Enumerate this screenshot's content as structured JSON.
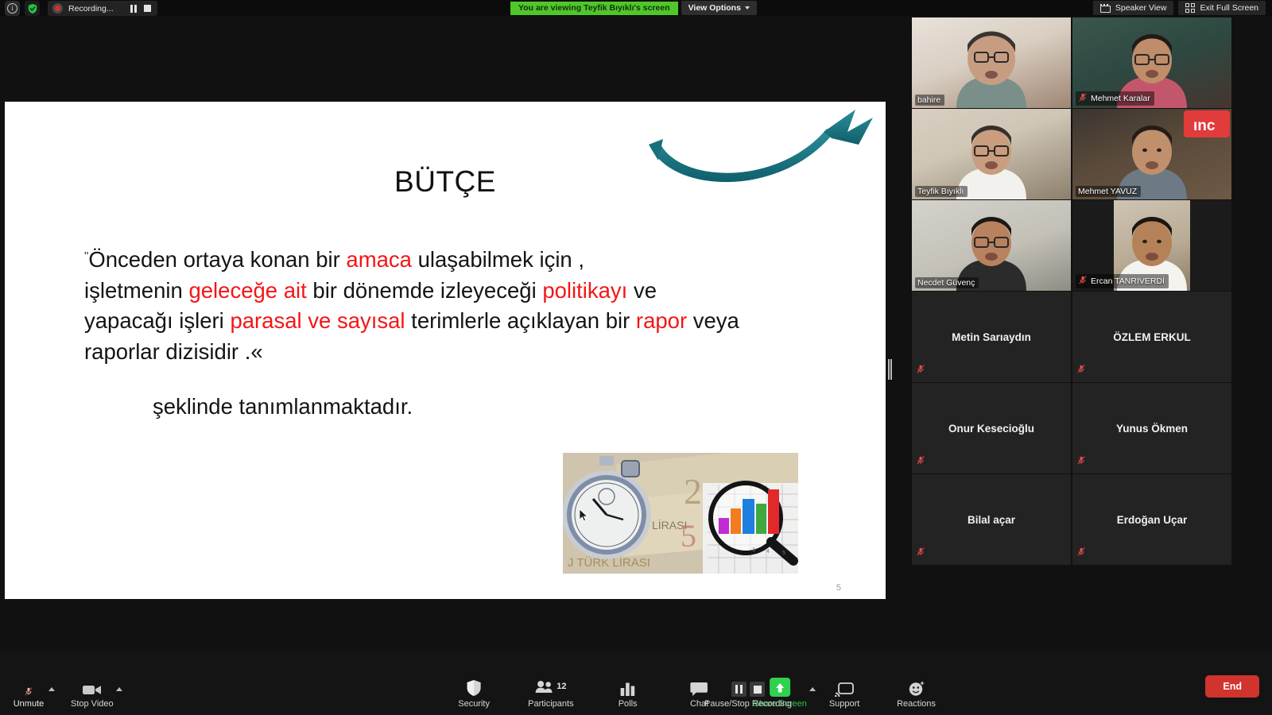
{
  "topbar": {
    "info_icon": "info-icon",
    "shield_icon": "shield-check-icon",
    "recording_label": "Recording...",
    "pause_icon": "pause-icon",
    "stop_icon": "stop-icon",
    "share_banner": "You are viewing Teyfik Bıyıklı's screen",
    "view_options": "View Options",
    "speaker_view": "Speaker View",
    "exit_full_screen": "Exit Full Screen"
  },
  "slide": {
    "title": "BÜTÇE",
    "quote_open": "\"",
    "body_lines": [
      {
        "parts": [
          {
            "t": "Önceden ortaya konan bir ",
            "hl": false
          },
          {
            "t": "amaca",
            "hl": true
          },
          {
            "t": " ulaşabilmek için ,",
            "hl": false
          }
        ]
      },
      {
        "parts": [
          {
            "t": "işletmenin ",
            "hl": false
          },
          {
            "t": "geleceğe ait",
            "hl": true
          },
          {
            "t": " bir dönemde izleyeceği ",
            "hl": false
          },
          {
            "t": "politikayı",
            "hl": true
          },
          {
            "t": " ve",
            "hl": false
          }
        ]
      },
      {
        "parts": [
          {
            "t": "yapacağı işleri ",
            "hl": false
          },
          {
            "t": "parasal ve sayısal",
            "hl": true
          },
          {
            "t": " terimlerle açıklayan bir ",
            "hl": false
          },
          {
            "t": "rapor",
            "hl": true
          },
          {
            "t": " veya",
            "hl": false
          }
        ]
      },
      {
        "parts": [
          {
            "t": "raporlar dizisidir .«",
            "hl": false
          }
        ]
      }
    ],
    "closing_line": "şeklinde tanımlanmaktadır.",
    "page_number": "5",
    "photo_alt": "stopwatch-lira-banknotes-bar-chart-magnifier",
    "swoosh_color": "#1b7f8c",
    "highlight_color": "#f41616"
  },
  "participants": [
    {
      "name": "bahire",
      "video": true,
      "muted": false,
      "active": false
    },
    {
      "name": "Mehmet Karalar",
      "video": true,
      "muted": true,
      "active": false
    },
    {
      "name": "Teyfik Bıyıklı",
      "video": true,
      "muted": false,
      "active": true
    },
    {
      "name": "Mehmet YAVUZ",
      "video": true,
      "muted": false,
      "active": false
    },
    {
      "name": "Necdet Güvenç",
      "video": true,
      "muted": false,
      "active": false
    },
    {
      "name": "Ercan TANRIVERDİ",
      "video": true,
      "muted": true,
      "active": false
    },
    {
      "name": "Metin Sarıaydın",
      "video": false,
      "muted": true,
      "active": false
    },
    {
      "name": "ÖZLEM ERKUL",
      "video": false,
      "muted": true,
      "active": false
    },
    {
      "name": "Onur Kesecioğlu",
      "video": false,
      "muted": true,
      "active": false
    },
    {
      "name": "Yunus Ökmen",
      "video": false,
      "muted": true,
      "active": false
    },
    {
      "name": "Bilal açar",
      "video": false,
      "muted": true,
      "active": false
    },
    {
      "name": "Erdoğan Uçar",
      "video": false,
      "muted": true,
      "active": false
    }
  ],
  "toolbar": {
    "unmute": "Unmute",
    "stop_video": "Stop Video",
    "security": "Security",
    "participants": "Participants",
    "participants_count": "12",
    "polls": "Polls",
    "chat": "Chat",
    "share_screen": "Share Screen",
    "pause_stop_recording": "Pause/Stop Recording",
    "support": "Support",
    "reactions": "Reactions",
    "end": "End",
    "accent_green": "#2fd14f",
    "end_red": "#d0342c"
  }
}
